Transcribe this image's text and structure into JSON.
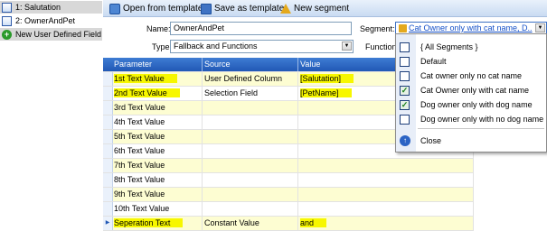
{
  "left_list": {
    "items": [
      {
        "label": "1: Salutation",
        "icon": "document-icon",
        "selected": true
      },
      {
        "label": "2: OwnerAndPet",
        "icon": "document-icon",
        "selected": false
      },
      {
        "label": "New User Defined Field",
        "icon": "add-icon",
        "selected": true
      }
    ]
  },
  "toolbar": {
    "open_template": "Open from template",
    "save_template": "Save as template",
    "new_segment": "New segment"
  },
  "form": {
    "name_label": "Name:",
    "name_value": "OwnerAndPet",
    "type_label": "Type:",
    "type_value": "Fallback and Functions",
    "function_label": "Function",
    "segment_label": "Segment:",
    "segment_value": "Cat Owner only with cat name, D.."
  },
  "grid": {
    "columns": [
      "Parameter",
      "Source",
      "Value"
    ],
    "rows": [
      {
        "parameter": "1st Text Value",
        "source": "User Defined Column",
        "value": "[Salutation]"
      },
      {
        "parameter": "2nd Text Value",
        "source": "Selection Field",
        "value": "[PetName]"
      },
      {
        "parameter": "3rd Text Value",
        "source": "",
        "value": ""
      },
      {
        "parameter": "4th Text Value",
        "source": "",
        "value": ""
      },
      {
        "parameter": "5th Text Value",
        "source": "",
        "value": ""
      },
      {
        "parameter": "6th Text Value",
        "source": "",
        "value": ""
      },
      {
        "parameter": "7th Text Value",
        "source": "",
        "value": ""
      },
      {
        "parameter": "8th Text Value",
        "source": "",
        "value": ""
      },
      {
        "parameter": "9th Text Value",
        "source": "",
        "value": ""
      },
      {
        "parameter": "10th Text Value",
        "source": "",
        "value": ""
      },
      {
        "parameter": "Seperation Text",
        "source": "Constant Value",
        "value": "and"
      }
    ]
  },
  "segment_dropdown": {
    "items": [
      {
        "label": "{ All Segments }",
        "checked": false
      },
      {
        "label": "Default",
        "checked": false
      },
      {
        "label": "Cat owner only no cat name",
        "checked": false
      },
      {
        "label": "Cat Owner only with cat name",
        "checked": true
      },
      {
        "label": "Dog owner only with dog name",
        "checked": true
      },
      {
        "label": "Dog owner only with no dog name",
        "checked": false
      }
    ],
    "close_label": "Close"
  },
  "colors": {
    "highlight": "#f7f700",
    "grid_header": "#2158b5",
    "alt_row": "#fdfdd2"
  }
}
